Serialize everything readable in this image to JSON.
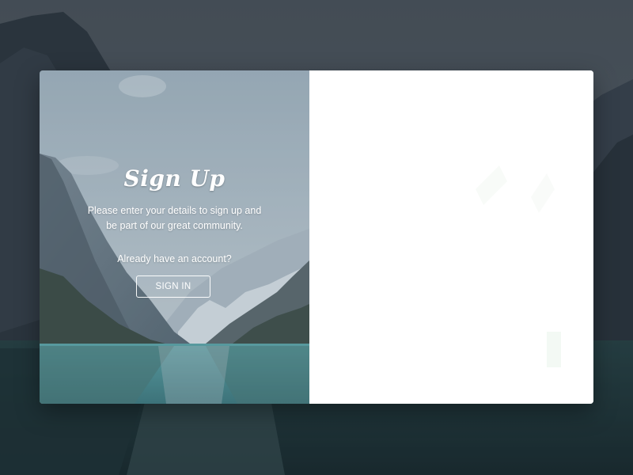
{
  "signup_panel": {
    "title": "Sign Up",
    "description": "Please enter your details to sign up and be part of our great community.",
    "already_text": "Already have an account?",
    "signin_label": "SIGN IN"
  },
  "colors": {
    "sky": "#9fb0bd",
    "mountain_dark": "#2f3a46",
    "lake": "#3c7b80",
    "panel_right": "#ffffff"
  },
  "icons": {
    "background": "mountain-lake-landscape"
  }
}
